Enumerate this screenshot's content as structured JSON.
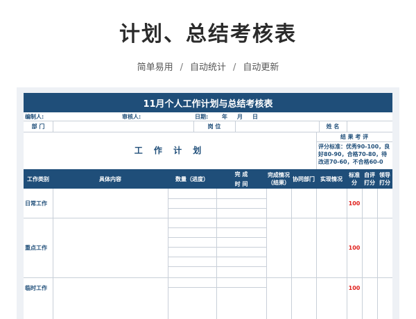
{
  "hero": {
    "title": "计划、总结考核表",
    "sub1": "简单易用",
    "sep": "/",
    "sub2": "自动统计",
    "sub3": "自动更新"
  },
  "sheet": {
    "title": "11月个人工作计划与总结考核表",
    "compiler": "编制人:",
    "reviewer": "审核人:",
    "date_label": "日期:",
    "year": "年",
    "month": "月",
    "day": "日",
    "dept": "部 门",
    "position": "岗 位",
    "name": "姓 名",
    "result_title": "结 果 考 评",
    "criteria": "评分标准：优秀90-100，良好80-90，合格70-80，待改进70-60，不合格60-0",
    "plan_title": "工 作 计 划",
    "headers": {
      "category": "工作类别",
      "content": "具体内容",
      "quantity": "数量（进度）",
      "finish": "完 成",
      "time": "时 间",
      "status": "完成情况（结果）",
      "coop": "协同部门",
      "actual": "实现情况",
      "standard": "标准分",
      "self": "自评打分",
      "leader": "领导打分"
    },
    "rows": [
      {
        "category": "日常工作",
        "score": "100"
      },
      {
        "category": "重点工作",
        "score": "100"
      },
      {
        "category": "临时工作",
        "score": "100"
      }
    ]
  }
}
